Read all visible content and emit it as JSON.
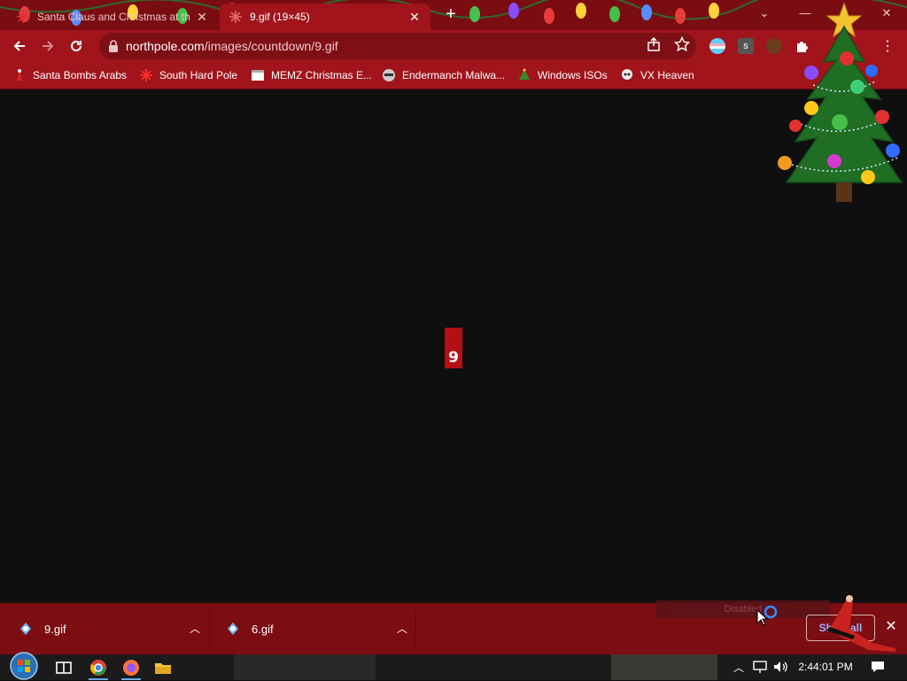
{
  "browser": {
    "tabs": [
      {
        "title": "Santa Claus and Christmas at th",
        "active": false
      },
      {
        "title": "9.gif (19×45)",
        "active": true
      }
    ],
    "new_tab_label": "+",
    "url_domain": "northpole.com",
    "url_path": "/images/countdown/9.gif"
  },
  "bookmarks": [
    {
      "label": "Santa Bombs Arabs",
      "icon": "santa-icon"
    },
    {
      "label": "South Hard Pole",
      "icon": "snowflake-icon"
    },
    {
      "label": "MEMZ Christmas E...",
      "icon": "page-icon"
    },
    {
      "label": "Endermanch Malwa...",
      "icon": "raccoon-icon"
    },
    {
      "label": "Windows ISOs",
      "icon": "tree-icon"
    },
    {
      "label": "VX Heaven",
      "icon": "skull-icon"
    }
  ],
  "content": {
    "gif_text": "9"
  },
  "downloads": {
    "items": [
      {
        "name": "9.gif"
      },
      {
        "name": "6.gif"
      }
    ],
    "tooltip": "Disabled",
    "show_all": "Show all"
  },
  "taskbar": {
    "clock": "2:44:01 PM"
  },
  "colors": {
    "frame": "#7a0d12",
    "toolbar": "#a1141b",
    "content_bg": "#0f0f10",
    "gif_red": "#b50f16"
  }
}
